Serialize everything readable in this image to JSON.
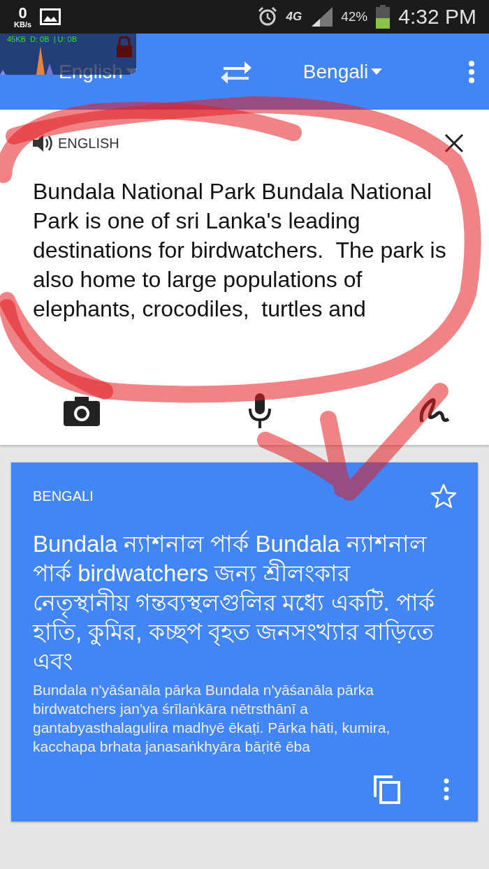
{
  "status_bar": {
    "speed": "0",
    "speed_unit": "KB/s",
    "network": "4G",
    "battery": "42%",
    "time": "4:32 PM"
  },
  "data_widget": {
    "text": "45KB  D: 0B  | U: 0B"
  },
  "toolbar": {
    "source_language": "English",
    "target_language": "Bengali"
  },
  "input": {
    "language": "ENGLISH",
    "text": "Bundala National Park Bundala National Park is one of sri Lanka's leading destinations for birdwatchers.  The park is also home to large populations of elephants, crocodiles,  turtles and"
  },
  "output": {
    "language": "BENGALI",
    "text": "Bundala ন্যাশনাল পার্ক Bundala ন্যাশনাল পার্ক birdwatchers জন্য শ্রীলংকার নেতৃস্থানীয় গন্তব্যস্থলগুলির মধ্যে একটি. পার্ক হাতি, কুমির, কচ্ছপ বৃহত জনসংখ্যার বাড়িতে এবং",
    "transliteration": "Bundala n'yāśanāla pārka Bundala n'yāśanāla pārka birdwatchers jan'ya śrīlaṅkāra nētrsthānī a gantabyasthalagulira madhyē ēkaṭi. Pārka hāti, kumira, kacchapa brhata janasaṅkhyāra bāṛitē ēba"
  }
}
